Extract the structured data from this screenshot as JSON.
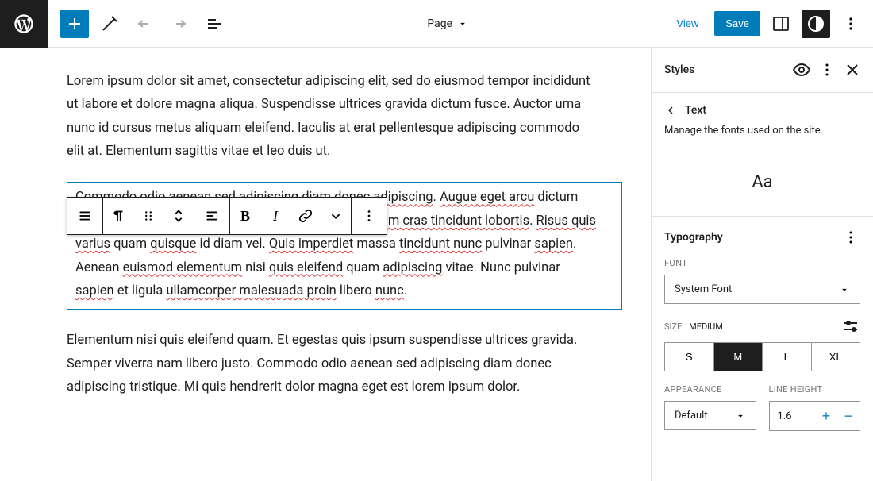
{
  "topbar": {
    "doc_type": "Page",
    "view": "View",
    "save": "Save"
  },
  "editor": {
    "para1": "Lorem ipsum dolor sit amet, consectetur adipiscing elit, sed do eiusmod tempor incididunt ut labore et dolore magna aliqua. Suspendisse ultrices gravida dictum fusce. Auctor urna nunc id cursus metus aliquam eleifend. Iaculis at erat pellentesque adipiscing commodo elit at. Elementum sagittis vitae et leo duis ut.",
    "para2_html": "<span class=\"spellwave\">Commodo odio aenean</span> sed <span class=\"spellwave\">adipiscing</span> diam <span class=\"spellwave\">donec adipiscing</span>. <span class=\"spellwave\">Augue eget arcu</span> dictum <span class=\"spellwave\">varius duis</span> at <span class=\"spellwave\">consectetur</span> lorem. <span class=\"spellwave\">Ullamcorper dignissim cras tincidunt lobortis</span>. <span class=\"spellwave\">Risus quis varius</span> quam <span class=\"spellwave\">quisque</span> id diam vel. <span class=\"spellwave\">Quis imperdiet</span> massa <span class=\"spellwave\">tincidunt nunc</span> pulvinar <span class=\"spellwave\">sapien</span>. Aenean <span class=\"spellwave\">euismod elementum</span> nisi <span class=\"spellwave\">quis eleifend</span> quam <span class=\"spellwave\">adipiscing</span> vitae. Nunc pulvinar <span class=\"spellwave\">sapien</span> et ligula <span class=\"spellwave\">ullamcorper malesuada proin</span> libero <span class=\"spellwave\">nunc</span>.",
    "para3": "Elementum nisi quis eleifend quam. Et egestas quis ipsum suspendisse ultrices gravida. Semper viverra nam libero justo. Commodo odio aenean sed adipiscing diam donec adipiscing tristique. Mi quis hendrerit dolor magna eget est lorem ipsum dolor."
  },
  "sidebar": {
    "title": "Styles",
    "back_label": "Text",
    "description": "Manage the fonts used on the site.",
    "preview": "Aa",
    "typography": {
      "title": "Typography",
      "font_label": "FONT",
      "font_value": "System Font",
      "size_label": "SIZE",
      "size_active": "MEDIUM",
      "sizes": [
        "S",
        "M",
        "L",
        "XL"
      ],
      "size_selected": "M",
      "appearance_label": "APPEARANCE",
      "appearance_value": "Default",
      "line_height_label": "LINE HEIGHT",
      "line_height_value": "1.6"
    }
  }
}
